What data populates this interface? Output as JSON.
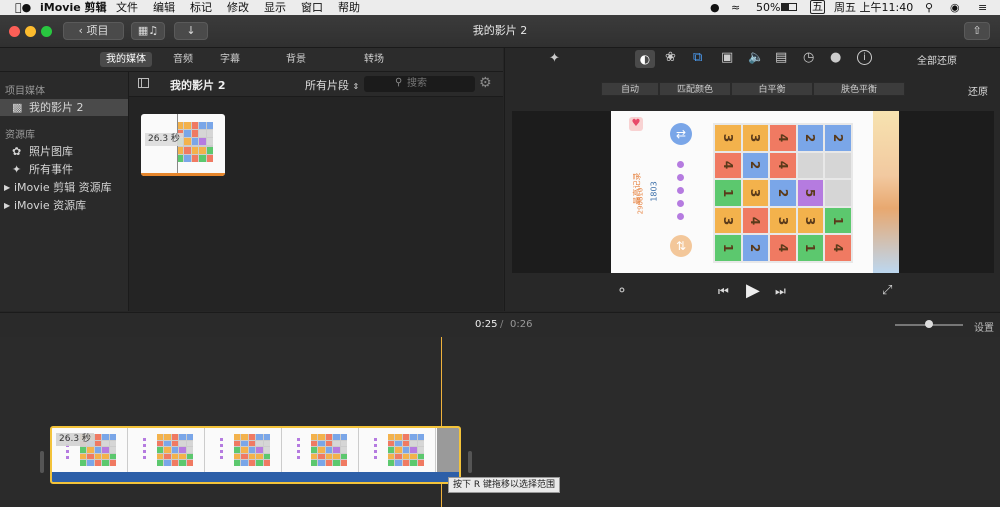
{
  "menubar": {
    "app": "iMovie 剪辑",
    "menus": [
      "文件",
      "编辑",
      "标记",
      "修改",
      "显示",
      "窗口",
      "帮助"
    ],
    "battery": "50%",
    "ime": "五",
    "clock": "周五 上午11:40"
  },
  "toolbar": {
    "back_label": "项目",
    "title": "我的影片 2"
  },
  "tabs": [
    "我的媒体",
    "音频",
    "字幕",
    "背景",
    "转场"
  ],
  "sidebar": {
    "project_header": "项目媒体",
    "project_item": "我的影片 2",
    "library_header": "资源库",
    "library_items": [
      "照片图库",
      "所有事件"
    ],
    "libraries": [
      "iMovie 剪辑 资源库",
      "iMovie 资源库"
    ]
  },
  "browser": {
    "title": "我的影片 2",
    "filter": "所有片段",
    "search_placeholder": "搜索",
    "clip_duration": "26.3 秒"
  },
  "viewer": {
    "reset_all": "全部还原",
    "adjust_buttons": [
      "自动",
      "匹配颜色",
      "白平衡",
      "肤色平衡"
    ],
    "reset": "还原"
  },
  "game": {
    "record_label": "最高记录",
    "record_value": "290810",
    "score": "1803",
    "grid": [
      [
        3,
        3,
        4,
        2,
        2
      ],
      [
        4,
        2,
        4,
        0,
        0
      ],
      [
        1,
        3,
        2,
        5,
        0
      ],
      [
        3,
        4,
        3,
        3,
        1
      ],
      [
        1,
        2,
        4,
        1,
        4
      ]
    ],
    "colors": {
      "1": "#5cc86e",
      "2": "#7aa6e8",
      "3": "#f3b24c",
      "4": "#f07a62",
      "5": "#b57be0",
      "0": "#d6d6d6"
    }
  },
  "timeline": {
    "current": "0:25",
    "separator": "/",
    "total": "0:26",
    "settings": "设置",
    "clip_duration": "26.3 秒",
    "tooltip": "按下 R 键拖移以选择范围"
  }
}
